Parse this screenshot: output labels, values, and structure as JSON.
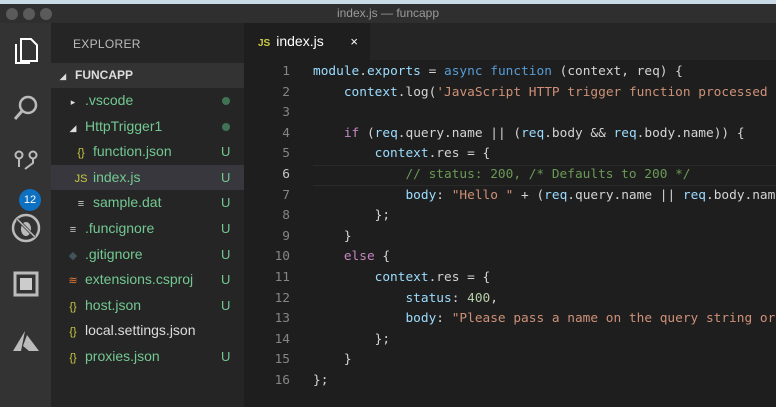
{
  "window": {
    "title": "index.js — funcapp"
  },
  "activity_bar": [
    {
      "icon": "files-icon"
    },
    {
      "icon": "search-icon"
    },
    {
      "icon": "source-control-icon",
      "badge": "12"
    },
    {
      "icon": "debug-icon"
    },
    {
      "icon": "extensions-icon"
    },
    {
      "icon": "azure-icon"
    }
  ],
  "explorer": {
    "title": "EXPLORER",
    "root": "FUNCAPP",
    "items": [
      {
        "label": ".vscode",
        "icon": "chevron-right-icon",
        "indent": 1,
        "status": "dot"
      },
      {
        "label": "HttpTrigger1",
        "icon": "chevron-down-icon",
        "indent": 1,
        "status": "dot"
      },
      {
        "label": "function.json",
        "icon": "json-icon",
        "indent": 2,
        "status": "U"
      },
      {
        "label": "index.js",
        "icon": "js-icon",
        "indent": 2,
        "status": "U",
        "selected": true
      },
      {
        "label": "sample.dat",
        "icon": "file-lines-icon",
        "indent": 2,
        "status": "U"
      },
      {
        "label": ".funcignore",
        "icon": "file-lines-icon",
        "indent": 1,
        "status": "U"
      },
      {
        "label": ".gitignore",
        "icon": "git-icon",
        "indent": 1,
        "status": "U"
      },
      {
        "label": "extensions.csproj",
        "icon": "rss-icon",
        "indent": 1,
        "status": "U"
      },
      {
        "label": "host.json",
        "icon": "json-icon",
        "indent": 1,
        "status": "U"
      },
      {
        "label": "local.settings.json",
        "icon": "json-icon",
        "indent": 1,
        "status": "",
        "plain": true
      },
      {
        "label": "proxies.json",
        "icon": "json-icon",
        "indent": 1,
        "status": "U"
      }
    ]
  },
  "editor": {
    "tab": {
      "icon_text": "JS",
      "label": "index.js",
      "close": "×"
    },
    "current_line": 6,
    "lines": [
      [
        [
          "module",
          "var"
        ],
        [
          ".",
          "p"
        ],
        [
          "exports",
          "var"
        ],
        [
          " = ",
          "p"
        ],
        [
          "async",
          "kw"
        ],
        [
          " ",
          "p"
        ],
        [
          "function",
          "kw"
        ],
        [
          " (context, req) {",
          "p"
        ]
      ],
      [
        [
          "    ",
          "p"
        ],
        [
          "context",
          "var"
        ],
        [
          ".",
          "p"
        ],
        [
          "log",
          "p"
        ],
        [
          "(",
          "p"
        ],
        [
          "'JavaScript HTTP trigger function processed",
          "str"
        ]
      ],
      [],
      [
        [
          "    ",
          "p"
        ],
        [
          "if",
          "ctl"
        ],
        [
          " (",
          "p"
        ],
        [
          "req",
          "var"
        ],
        [
          ".query.name || (",
          "p"
        ],
        [
          "req",
          "var"
        ],
        [
          ".body && ",
          "p"
        ],
        [
          "req",
          "var"
        ],
        [
          ".body.name)) {",
          "p"
        ]
      ],
      [
        [
          "        ",
          "p"
        ],
        [
          "context",
          "var"
        ],
        [
          ".res = {",
          "p"
        ]
      ],
      [
        [
          "            ",
          "p"
        ],
        [
          "// status: 200, /* Defaults to 200 */",
          "cm"
        ]
      ],
      [
        [
          "            ",
          "p"
        ],
        [
          "body",
          "var"
        ],
        [
          ": ",
          "p"
        ],
        [
          "\"Hello \"",
          "str"
        ],
        [
          " + (",
          "p"
        ],
        [
          "req",
          "var"
        ],
        [
          ".query.name || ",
          "p"
        ],
        [
          "req",
          "var"
        ],
        [
          ".body.nam",
          "p"
        ]
      ],
      [
        [
          "        };",
          "p"
        ]
      ],
      [
        [
          "    }",
          "p"
        ]
      ],
      [
        [
          "    ",
          "p"
        ],
        [
          "else",
          "ctl"
        ],
        [
          " {",
          "p"
        ]
      ],
      [
        [
          "        ",
          "p"
        ],
        [
          "context",
          "var"
        ],
        [
          ".res = {",
          "p"
        ]
      ],
      [
        [
          "            ",
          "p"
        ],
        [
          "status",
          "var"
        ],
        [
          ": ",
          "p"
        ],
        [
          "400",
          "num"
        ],
        [
          ",",
          "p"
        ]
      ],
      [
        [
          "            ",
          "p"
        ],
        [
          "body",
          "var"
        ],
        [
          ": ",
          "p"
        ],
        [
          "\"Please pass a name on the query string or",
          "str"
        ]
      ],
      [
        [
          "        };",
          "p"
        ]
      ],
      [
        [
          "    }",
          "p"
        ]
      ],
      [
        [
          "};",
          "p"
        ]
      ]
    ]
  },
  "colors": {
    "accent": "#0e70c0",
    "untracked": "#73c991"
  }
}
